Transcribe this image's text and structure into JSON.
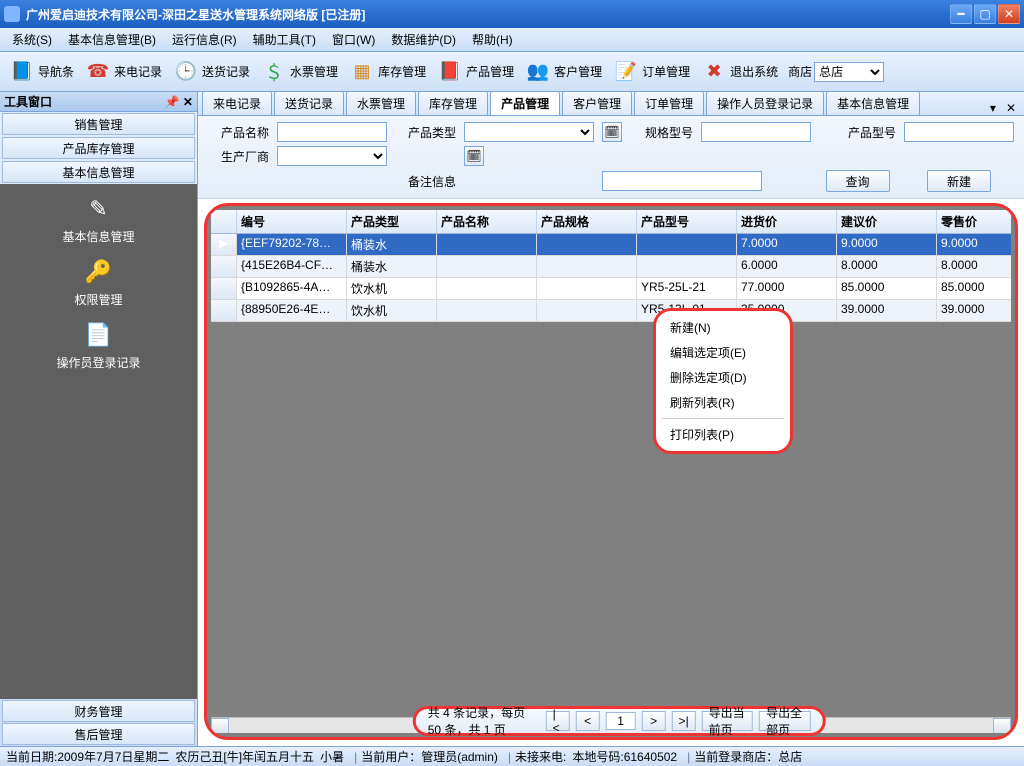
{
  "titlebar": {
    "title": "广州爱启迪技术有限公司-深田之星送水管理系统网络版  [已注册]"
  },
  "menubar": [
    "系统(S)",
    "基本信息管理(B)",
    "运行信息(R)",
    "辅助工具(T)",
    "窗口(W)",
    "数据维护(D)",
    "帮助(H)"
  ],
  "toolbar": {
    "items": [
      "导航条",
      "来电记录",
      "送货记录",
      "水票管理",
      "库存管理",
      "产品管理",
      "客户管理",
      "订单管理",
      "退出系统"
    ],
    "shop_label": "商店",
    "shop_value": "总店"
  },
  "sidebar": {
    "header": "工具窗口",
    "top_groups": [
      "销售管理",
      "产品库存管理",
      "基本信息管理"
    ],
    "items": [
      "基本信息管理",
      "权限管理",
      "操作员登录记录"
    ],
    "bottom_groups": [
      "财务管理",
      "售后管理"
    ]
  },
  "tabs": [
    "来电记录",
    "送货记录",
    "水票管理",
    "库存管理",
    "产品管理",
    "客户管理",
    "订单管理",
    "操作人员登录记录",
    "基本信息管理"
  ],
  "active_tab_index": 4,
  "filter": {
    "labels": {
      "name": "产品名称",
      "type": "产品类型",
      "spec": "规格型号",
      "model": "产品型号",
      "maker": "生产厂商",
      "note": "备注信息"
    },
    "values": {
      "name": "",
      "type": "",
      "spec": "",
      "model": "",
      "maker": "",
      "note": ""
    },
    "btn_query": "查询",
    "btn_new": "新建"
  },
  "grid": {
    "columns": [
      "",
      "编号",
      "产品类型",
      "产品名称",
      "产品规格",
      "产品型号",
      "进货价",
      "建议价",
      "零售价"
    ],
    "rows": [
      {
        "sel": true,
        "cells": [
          "▶",
          "{EEF79202-78…",
          "桶装水",
          "",
          "",
          "",
          "7.0000",
          "9.0000",
          "9.0000"
        ]
      },
      {
        "sel": false,
        "cells": [
          "",
          "{415E26B4-CF…",
          "桶装水",
          "",
          "",
          "",
          "6.0000",
          "8.0000",
          "8.0000"
        ]
      },
      {
        "sel": false,
        "cells": [
          "",
          "{B1092865-4A…",
          "饮水机",
          "",
          "",
          "YR5-25L-21",
          "77.0000",
          "85.0000",
          "85.0000"
        ]
      },
      {
        "sel": false,
        "cells": [
          "",
          "{88950E26-4E…",
          "饮水机",
          "",
          "",
          "YR5-13L-01",
          "35.0000",
          "39.0000",
          "39.0000"
        ]
      }
    ]
  },
  "context_menu": [
    "新建(N)",
    "编辑选定项(E)",
    "删除选定项(D)",
    "刷新列表(R)",
    "打印列表(P)"
  ],
  "pager": {
    "summary": "共 4 条记录，每页 50 条，共 1 页",
    "page": "1",
    "btn_first": "|<",
    "btn_prev": "<",
    "btn_next": ">",
    "btn_last": ">|",
    "btn_export_page": "导出当前页",
    "btn_export_all": "导出全部页"
  },
  "statusbar": {
    "date": "当前日期:2009年7月7日星期二",
    "lunar": "农历己丑[牛]年闰五月十五",
    "term": "小暑",
    "user": "当前用户：管理员(admin)",
    "incoming": "未接来电:",
    "local": "本地号码:61640502",
    "shop": "当前登录商店：总店"
  }
}
